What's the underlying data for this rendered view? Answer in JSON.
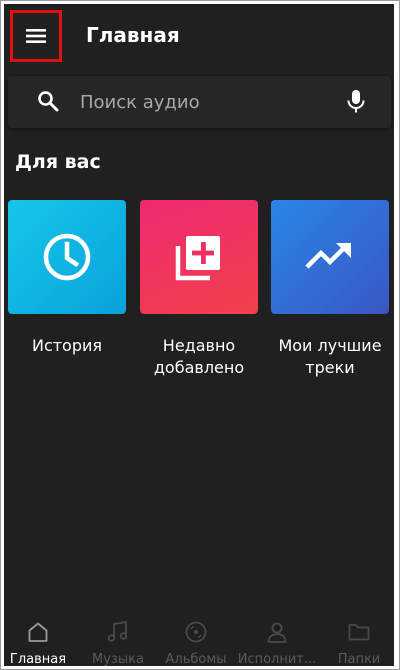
{
  "header": {
    "title": "Главная"
  },
  "search": {
    "placeholder": "Поиск аудио"
  },
  "for_you": {
    "title": "Для вас",
    "cards": [
      {
        "label": "История",
        "icon": "clock-icon",
        "color": "#12b4e4"
      },
      {
        "label": "Недавно добавлено",
        "icon": "add-to-playlist-icon",
        "color": "#f0365e"
      },
      {
        "label": "Мои лучшие треки",
        "icon": "trending-up-icon",
        "color": "#3170d6"
      }
    ]
  },
  "bottom_nav": {
    "items": [
      {
        "label": "Главная",
        "icon": "home-icon",
        "active": true
      },
      {
        "label": "Музыка",
        "icon": "music-note-icon",
        "active": false
      },
      {
        "label": "Альбомы",
        "icon": "album-icon",
        "active": false
      },
      {
        "label": "Исполнит...",
        "icon": "person-icon",
        "active": false
      },
      {
        "label": "Папки",
        "icon": "folder-icon",
        "active": false
      }
    ]
  },
  "colors": {
    "background": "#202020",
    "highlight_border": "#e01010",
    "active_text": "#ffffff",
    "inactive_text": "#5a5a5a"
  }
}
